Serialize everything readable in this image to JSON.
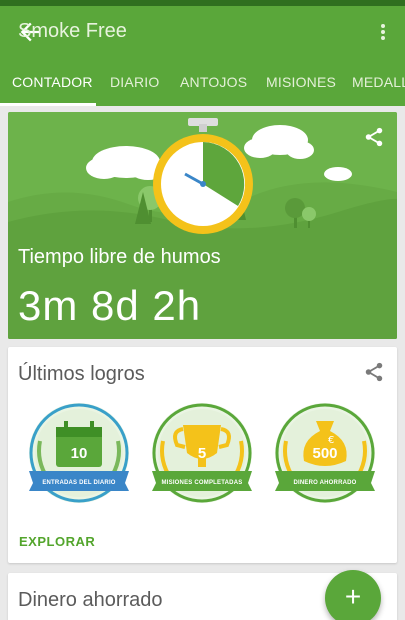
{
  "app": {
    "title": "Smoke Free"
  },
  "icons": {
    "back": "arrow-back-icon",
    "more": "more-vert-icon",
    "share": "share-icon",
    "add": "plus-icon"
  },
  "tabs": [
    {
      "label": "CONTADOR",
      "active": true
    },
    {
      "label": "DIARIO"
    },
    {
      "label": "ANTOJOS"
    },
    {
      "label": "MISIONES"
    },
    {
      "label": "MEDALL"
    }
  ],
  "hero": {
    "label": "Tiempo libre de humos",
    "time": "3m 8d 2h"
  },
  "achievements": {
    "title": "Últimos logros",
    "badges": [
      {
        "value": "10",
        "caption": "ENTRADAS DEL DIARIO",
        "icon": "calendar-icon"
      },
      {
        "value": "5",
        "caption": "MISIONES COMPLETADAS",
        "icon": "trophy-icon"
      },
      {
        "value": "500",
        "caption": "DINERO AHORRADO",
        "icon": "money-bag-icon"
      }
    ],
    "action": "EXPLORAR"
  },
  "money_card": {
    "title": "Dinero ahorrado"
  },
  "colors": {
    "primary": "#5aa73a",
    "accent": "#53a52c",
    "dark": "#2f6f1f",
    "gold": "#f4c21a"
  }
}
